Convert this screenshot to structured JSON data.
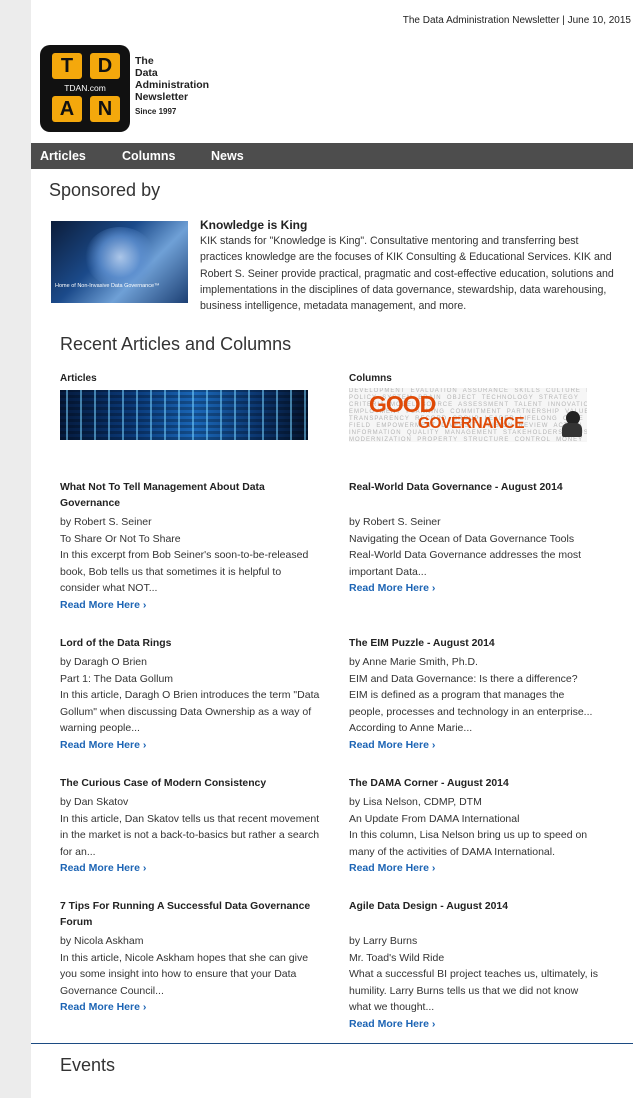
{
  "header": {
    "top_line": "The Data Administration Newsletter | June 10, 2015",
    "logo": {
      "tiles": [
        "T",
        "D",
        "A",
        "N"
      ],
      "domain": "TDAN.com",
      "name_lines": [
        "The",
        "Data",
        "Administration",
        "Newsletter"
      ],
      "since": "Since 1997"
    }
  },
  "nav": {
    "items": [
      "Articles",
      "Columns",
      "News"
    ]
  },
  "sponsor": {
    "heading": "Sponsored by",
    "image_caption": "Home of Non-Invasive Data Governance™",
    "title": "Knowledge is King",
    "description": "KIK stands for \"Knowledge is King\". Consultative mentoring and transferring best practices knowledge are the focuses of KIK Consulting & Educational Services. KIK and Robert S. Seiner provide practical, pragmatic and cost-effective education, solutions and implementations in the disciplines of data governance, stewardship, data warehousing, business intelligence, metadata management, and more."
  },
  "recent": {
    "heading": "Recent Articles and Columns",
    "articles_label": "Articles",
    "columns_label": "Columns",
    "columns_image_words": [
      "GOOD",
      "GOVERNANCE"
    ],
    "articles": [
      {
        "title": "What Not To Tell Management About Data Governance",
        "author": "by Robert S. Seiner",
        "subtitle": "To Share Or Not To Share",
        "excerpt": "In this excerpt from Bob Seiner's soon-to-be-released book, Bob tells us that sometimes it is helpful to consider what NOT...",
        "more": "Read More Here ›"
      },
      {
        "title": "Lord of the Data Rings",
        "author": "by Daragh O Brien",
        "subtitle": "Part 1: The Data Gollum",
        "excerpt": "In this article, Daragh O Brien introduces the term \"Data Gollum\" when discussing Data Ownership as a way of warning people...",
        "more": "Read More Here ›"
      },
      {
        "title": "The Curious Case of Modern Consistency",
        "author": "by Dan Skatov",
        "subtitle": "",
        "excerpt": "In this article, Dan Skatov tells us that recent movement in the market is not a back-to-basics but rather a search for an...",
        "more": "Read More Here ›"
      },
      {
        "title": "7 Tips For Running A Successful Data Governance Forum",
        "author": "by Nicola Askham",
        "subtitle": "",
        "excerpt": "In this article, Nicole Askham hopes that she can give you some insight into how to ensure that your Data Governance Council...",
        "more": "Read More Here ›"
      }
    ],
    "columns": [
      {
        "title": "Real-World Data Governance - August 2014",
        "author": "by Robert S. Seiner",
        "subtitle": "Navigating the Ocean of Data Governance Tools",
        "excerpt": "Real-World Data Governance addresses the most important Data...",
        "more": "Read More Here ›"
      },
      {
        "title": "The EIM Puzzle - August 2014",
        "author": "by Anne Marie Smith, Ph.D.",
        "subtitle": "EIM and Data Governance: Is there a difference?",
        "excerpt": "EIM is defined as a program that manages the people, processes and technology in an enterprise... According to Anne Marie...",
        "more": "Read More Here ›"
      },
      {
        "title": "The DAMA Corner - August 2014",
        "author": "by Lisa Nelson, CDMP, DTM",
        "subtitle": "An Update From DAMA International",
        "excerpt": "In this column, Lisa Nelson bring us up to speed on many of the activities of DAMA International.",
        "more": "Read More Here ›"
      },
      {
        "title": "Agile Data Design - August 2014",
        "author": "by Larry Burns",
        "subtitle": "Mr. Toad's Wild Ride",
        "excerpt": "What a successful BI project teaches us, ultimately, is humility. Larry Burns tells us that we did not know what we thought...",
        "more": "Read More Here ›"
      }
    ]
  },
  "events": {
    "heading": "Events"
  }
}
